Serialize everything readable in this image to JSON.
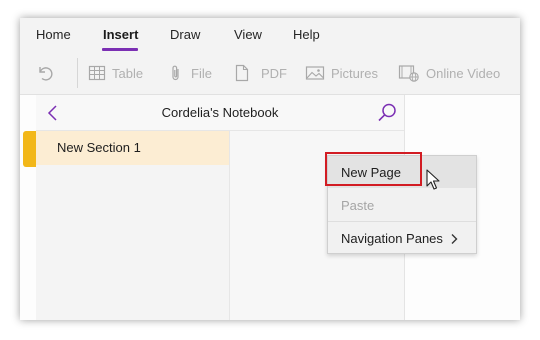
{
  "ribbon": {
    "tabs": [
      {
        "label": "Home"
      },
      {
        "label": "Insert"
      },
      {
        "label": "Draw"
      },
      {
        "label": "View"
      },
      {
        "label": "Help"
      }
    ],
    "active_tab": "Insert",
    "tools": {
      "undo": {
        "icon": "undo-icon"
      },
      "table": {
        "label": "Table",
        "icon": "table-icon"
      },
      "file": {
        "label": "File",
        "icon": "paperclip-icon"
      },
      "pdf": {
        "label": "PDF",
        "icon": "document-icon"
      },
      "pictures": {
        "label": "Pictures",
        "icon": "picture-icon"
      },
      "online_video": {
        "label": "Online Video",
        "icon": "online-video-icon"
      }
    }
  },
  "navigation": {
    "notebook_title": "Cordelia's Notebook",
    "sections": [
      {
        "label": "New Section 1"
      }
    ]
  },
  "context_menu": {
    "items": [
      {
        "label": "New Page",
        "enabled": true
      },
      {
        "label": "Paste",
        "enabled": false
      },
      {
        "label": "Navigation Panes",
        "enabled": true,
        "submenu": true
      }
    ]
  },
  "colors": {
    "accent": "#7b2fb3",
    "section_selected_bg": "#fcedd3",
    "section_tab": "#f2b718",
    "highlight_box": "#d21c23"
  }
}
